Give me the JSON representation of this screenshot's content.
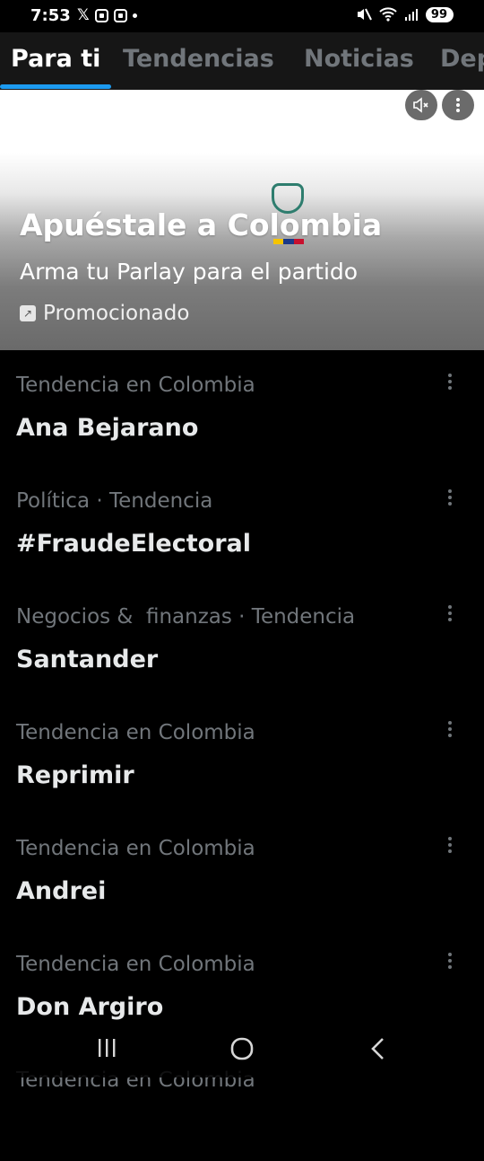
{
  "status": {
    "time": "7:53",
    "battery": "99"
  },
  "tabs": [
    {
      "label": "Para ti",
      "active": true
    },
    {
      "label": "Tendencias",
      "active": false
    },
    {
      "label": "Noticias",
      "active": false
    },
    {
      "label": "Dep",
      "active": false
    }
  ],
  "promo": {
    "title": "Apuéstale a Colombia",
    "subtitle": "Arma tu Parlay para el partido",
    "tag": "Promocionado"
  },
  "trends": [
    {
      "category": "Tendencia en Colombia",
      "name": "Ana Bejarano"
    },
    {
      "category": "Política · Tendencia",
      "name": "#FraudeElectoral"
    },
    {
      "category": "Negocios &  finanzas · Tendencia",
      "name": "Santander"
    },
    {
      "category": "Tendencia en Colombia",
      "name": "Reprimir"
    },
    {
      "category": "Tendencia en Colombia",
      "name": "Andrei"
    },
    {
      "category": "Tendencia en Colombia",
      "name": "Don Argiro"
    },
    {
      "category": "Tendencia en Colombia",
      "name": ""
    }
  ],
  "icons": {
    "mute": "mute-icon",
    "more": "more-vertical-icon",
    "recents": "recents-icon",
    "home": "home-icon",
    "back": "back-icon"
  },
  "colors": {
    "accent": "#1d9bf0",
    "secondary_text": "#71767b",
    "background": "#000000"
  }
}
